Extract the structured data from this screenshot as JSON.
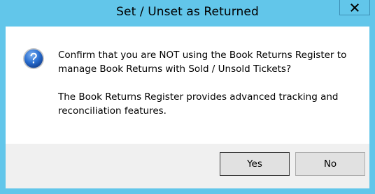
{
  "window": {
    "title": "Set / Unset as Returned"
  },
  "message": {
    "paragraph1": "Confirm that you are NOT using the Book Returns Register to manage Book Returns with Sold / Unsold Tickets?",
    "paragraph2": "The Book Returns Register provides advanced tracking and reconciliation features."
  },
  "icon": "question-icon",
  "buttons": {
    "yes_label": "Yes",
    "no_label": "No"
  },
  "colors": {
    "titlebar": "#62c6ea",
    "footer": "#f0f0f0",
    "button_face": "#e1e1e1",
    "icon_blue": "#1f5fb8"
  }
}
